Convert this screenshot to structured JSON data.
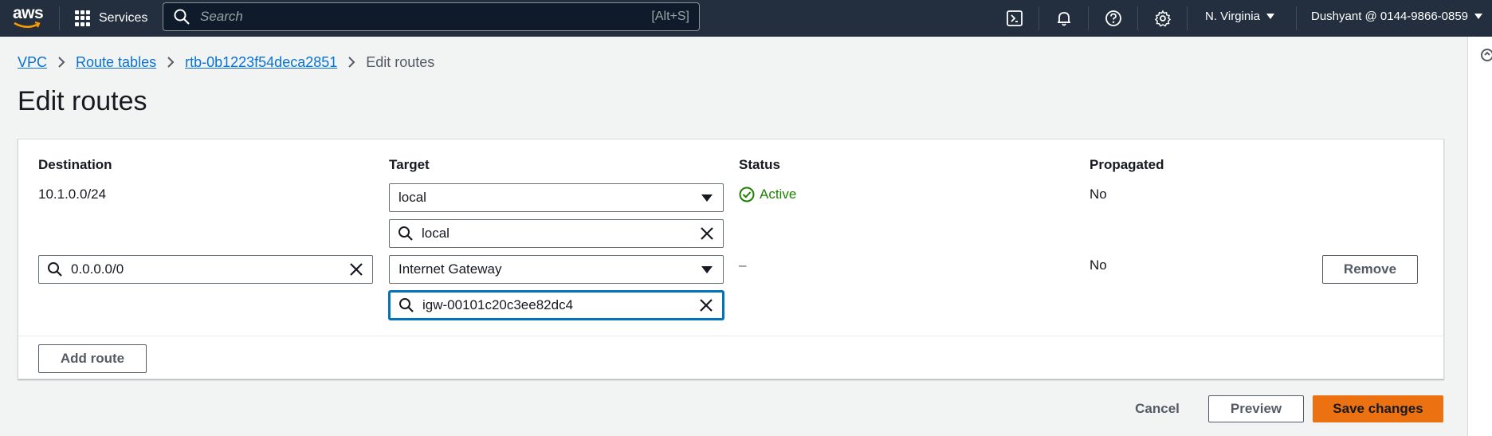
{
  "nav": {
    "logo_text": "aws",
    "services_label": "Services",
    "search_placeholder": "Search",
    "search_shortcut": "[Alt+S]",
    "region": "N. Virginia",
    "account": "Dushyant @ 0144-9866-0859"
  },
  "breadcrumb": {
    "items": [
      "VPC",
      "Route tables",
      "rtb-0b1223f54deca2851"
    ],
    "current": "Edit routes"
  },
  "page": {
    "title": "Edit routes"
  },
  "table": {
    "headers": {
      "destination": "Destination",
      "target": "Target",
      "status": "Status",
      "propagated": "Propagated"
    },
    "rows": [
      {
        "destination": "10.1.0.0/24",
        "target_type": "local",
        "target_value": "local",
        "status": "Active",
        "propagated": "No"
      },
      {
        "destination": "0.0.0.0/0",
        "target_type": "Internet Gateway",
        "target_value": "igw-00101c20c3ee82dc4",
        "status": "–",
        "propagated": "No",
        "remove_label": "Remove"
      }
    ],
    "add_route_label": "Add route"
  },
  "actions": {
    "cancel": "Cancel",
    "preview": "Preview",
    "save": "Save changes"
  },
  "colors": {
    "nav_bg": "#232f3e",
    "link": "#0972d3",
    "primary": "#ec7211",
    "success": "#1d8102",
    "focus": "#0073bb"
  },
  "icons": [
    "services-grid-icon",
    "search-icon",
    "cloudshell-icon",
    "notifications-bell-icon",
    "help-icon",
    "settings-gear-icon",
    "chevron-right-icon",
    "clear-x-icon",
    "status-check-icon",
    "dropdown-caret-icon"
  ]
}
